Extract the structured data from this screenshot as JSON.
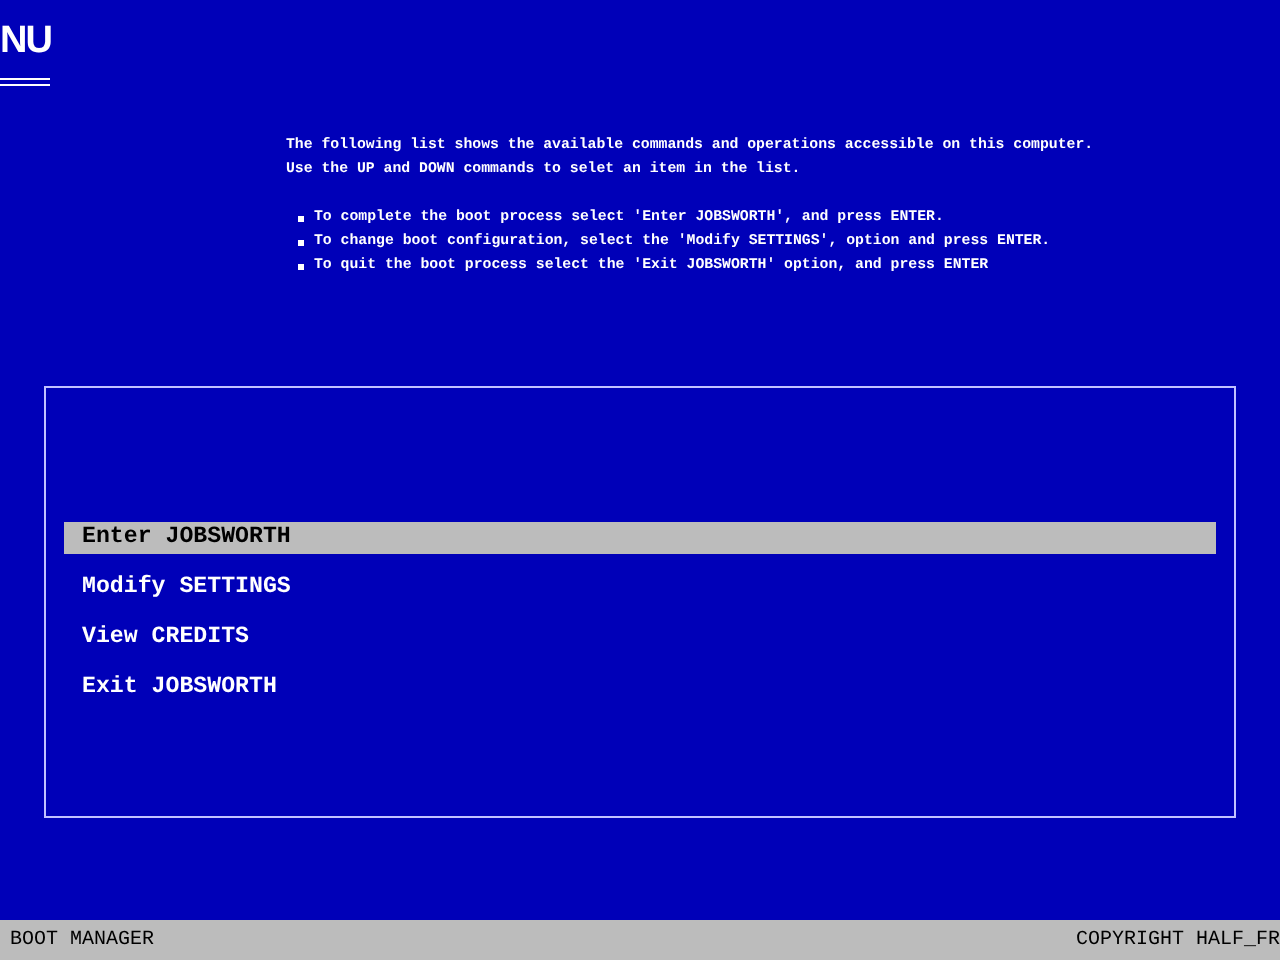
{
  "title": "NU",
  "intro": [
    "The following list shows the available commands and operations accessible on this computer.",
    "Use the UP and DOWN commands to selet an item in the list."
  ],
  "bullets": [
    "To complete the boot process select 'Enter JOBSWORTH', and press ENTER.",
    "To change boot configuration, select the 'Modify SETTINGS', option and press ENTER.",
    "To quit the boot process select the 'Exit JOBSWORTH' option, and press ENTER"
  ],
  "menu": [
    {
      "label": "Enter JOBSWORTH",
      "selected": true
    },
    {
      "label": "Modify SETTINGS",
      "selected": false
    },
    {
      "label": "View CREDITS",
      "selected": false
    },
    {
      "label": "Exit JOBSWORTH",
      "selected": false
    }
  ],
  "status_bar": {
    "left": "BOOT MANAGER",
    "right": "COPYRIGHT HALF_FR"
  }
}
